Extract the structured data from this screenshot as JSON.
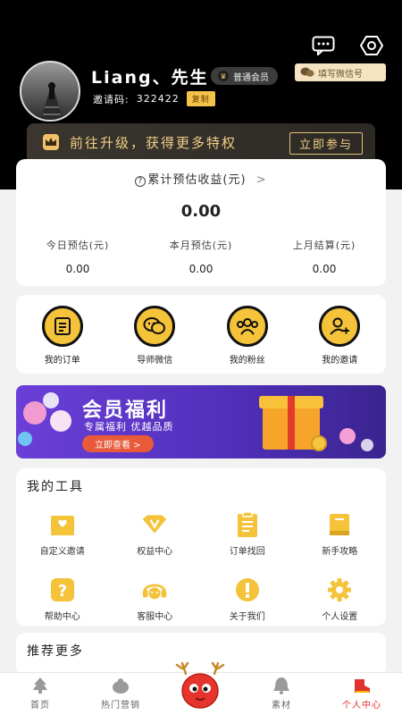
{
  "header": {
    "username": "Liang、先生",
    "member_level": "普通会员",
    "wechat_label": "填写微信号",
    "invite_label": "邀请码:",
    "invite_code": "322422",
    "copy_label": "复制"
  },
  "vip_bar": {
    "text": "前往升级，获得更多特权",
    "button": "立即参与"
  },
  "earnings": {
    "title": "累计预估收益(元)",
    "total": "0.00",
    "columns": [
      {
        "label": "今日预估(元)",
        "value": "0.00"
      },
      {
        "label": "本月预估(元)",
        "value": "0.00"
      },
      {
        "label": "上月结算(元)",
        "value": "0.00"
      }
    ]
  },
  "quick": [
    {
      "label": "我的订单",
      "icon": "orders-icon"
    },
    {
      "label": "导师微信",
      "icon": "wechat-icon"
    },
    {
      "label": "我的粉丝",
      "icon": "fans-icon"
    },
    {
      "label": "我的邀请",
      "icon": "invite-icon"
    }
  ],
  "banner": {
    "title": "会员福利",
    "subtitle": "专属福利 优越品质",
    "button": "立即查看 >"
  },
  "tools": {
    "title": "我的工具",
    "items": [
      {
        "label": "自定义邀请",
        "icon": "custom-invite-icon"
      },
      {
        "label": "权益中心",
        "icon": "benefits-icon"
      },
      {
        "label": "订单找回",
        "icon": "order-recovery-icon"
      },
      {
        "label": "新手攻略",
        "icon": "guide-icon"
      },
      {
        "label": "帮助中心",
        "icon": "help-icon"
      },
      {
        "label": "客服中心",
        "icon": "customer-service-icon"
      },
      {
        "label": "关于我们",
        "icon": "about-icon"
      },
      {
        "label": "个人设置",
        "icon": "settings-icon"
      }
    ]
  },
  "more": {
    "title": "推荐更多"
  },
  "tabbar": [
    {
      "label": "首页",
      "icon": "home-icon"
    },
    {
      "label": "热门营销",
      "icon": "hot-marketing-icon"
    },
    {
      "label": "",
      "icon": "mascot-icon"
    },
    {
      "label": "素材",
      "icon": "material-icon"
    },
    {
      "label": "个人中心",
      "icon": "profile-icon"
    }
  ],
  "colors": {
    "accent_yellow": "#f4c33a",
    "gold_text": "#f0cf86",
    "active_tab": "#e0322c",
    "header_bg": "#000000"
  }
}
